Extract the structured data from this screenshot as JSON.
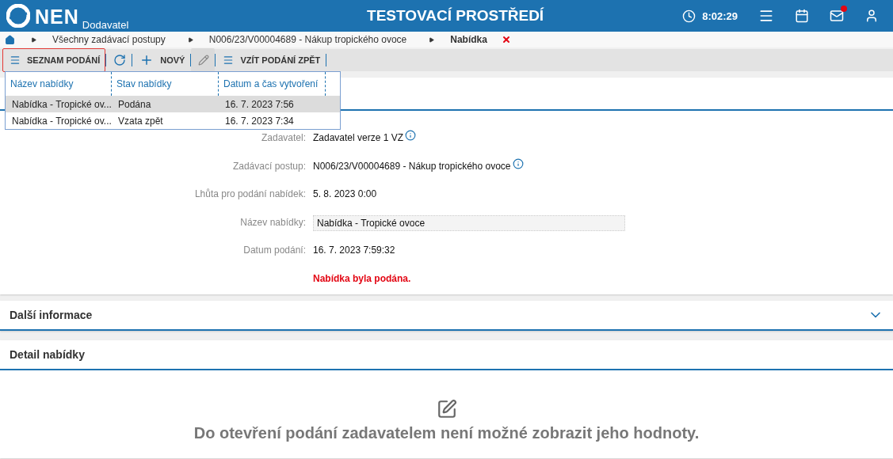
{
  "header": {
    "logo": "NEN",
    "subtitle": "Dodavatel",
    "title": "TESTOVACÍ PROSTŘEDÍ",
    "time": "8:02:29",
    "mail_unread": true
  },
  "breadcrumb": [
    {
      "label": "Všechny zadávací postupy",
      "current": false
    },
    {
      "label": "N006/23/V00004689 - Nákup tropického ovoce",
      "current": false
    },
    {
      "label": "Nabídka",
      "current": true
    }
  ],
  "toolbar": [
    {
      "kind": "list",
      "label": "SEZNAM PODÁNÍ",
      "selected": true,
      "disabled": false
    },
    {
      "kind": "refresh",
      "selected": false,
      "disabled": false
    },
    {
      "kind": "new",
      "label": "NOVÝ",
      "selected": false,
      "disabled": false
    },
    {
      "kind": "edit",
      "selected": false,
      "disabled": true
    },
    {
      "kind": "withdraw",
      "label": "VZÍT PODÁNÍ ZPĚT",
      "selected": false,
      "disabled": false
    }
  ],
  "submissions": {
    "columns": [
      "Název nabídky",
      "Stav nabídky",
      "Datum a čas vytvoření"
    ],
    "rows": [
      {
        "cells": [
          "Nabídka - Tropické ov...",
          "Podána",
          "16. 7. 2023 7:56"
        ],
        "selected": true
      },
      {
        "cells": [
          "Nabídka - Tropické ov...",
          "Vzata zpět",
          "16. 7. 2023 7:34"
        ],
        "selected": false
      }
    ]
  },
  "fields": [
    {
      "kind": "info",
      "label": "Zadavatel:",
      "value": "Zadavatel verze 1 VZ"
    },
    {
      "kind": "info",
      "label": "Zadávací postup:",
      "value": "N006/23/V00004689 - Nákup tropického ovoce"
    },
    {
      "kind": "text",
      "label": "Lhůta pro podání nabídek:",
      "value": "5. 8. 2023 0:00"
    },
    {
      "kind": "input",
      "label": "Název nabídky:",
      "value": "Nabídka - Tropické ovoce"
    },
    {
      "kind": "text",
      "label": "Datum podání:",
      "value": "16. 7. 2023 7:59:32"
    },
    {
      "kind": "message",
      "value": "Nabídka byla podána."
    }
  ],
  "sections": [
    {
      "title": "Další informace",
      "expanded": false
    },
    {
      "title": "Detail nabídky",
      "expanded": true,
      "empty_message": "Do otevření podání zadavatelem není možné zobrazit jeho hodnoty."
    }
  ]
}
